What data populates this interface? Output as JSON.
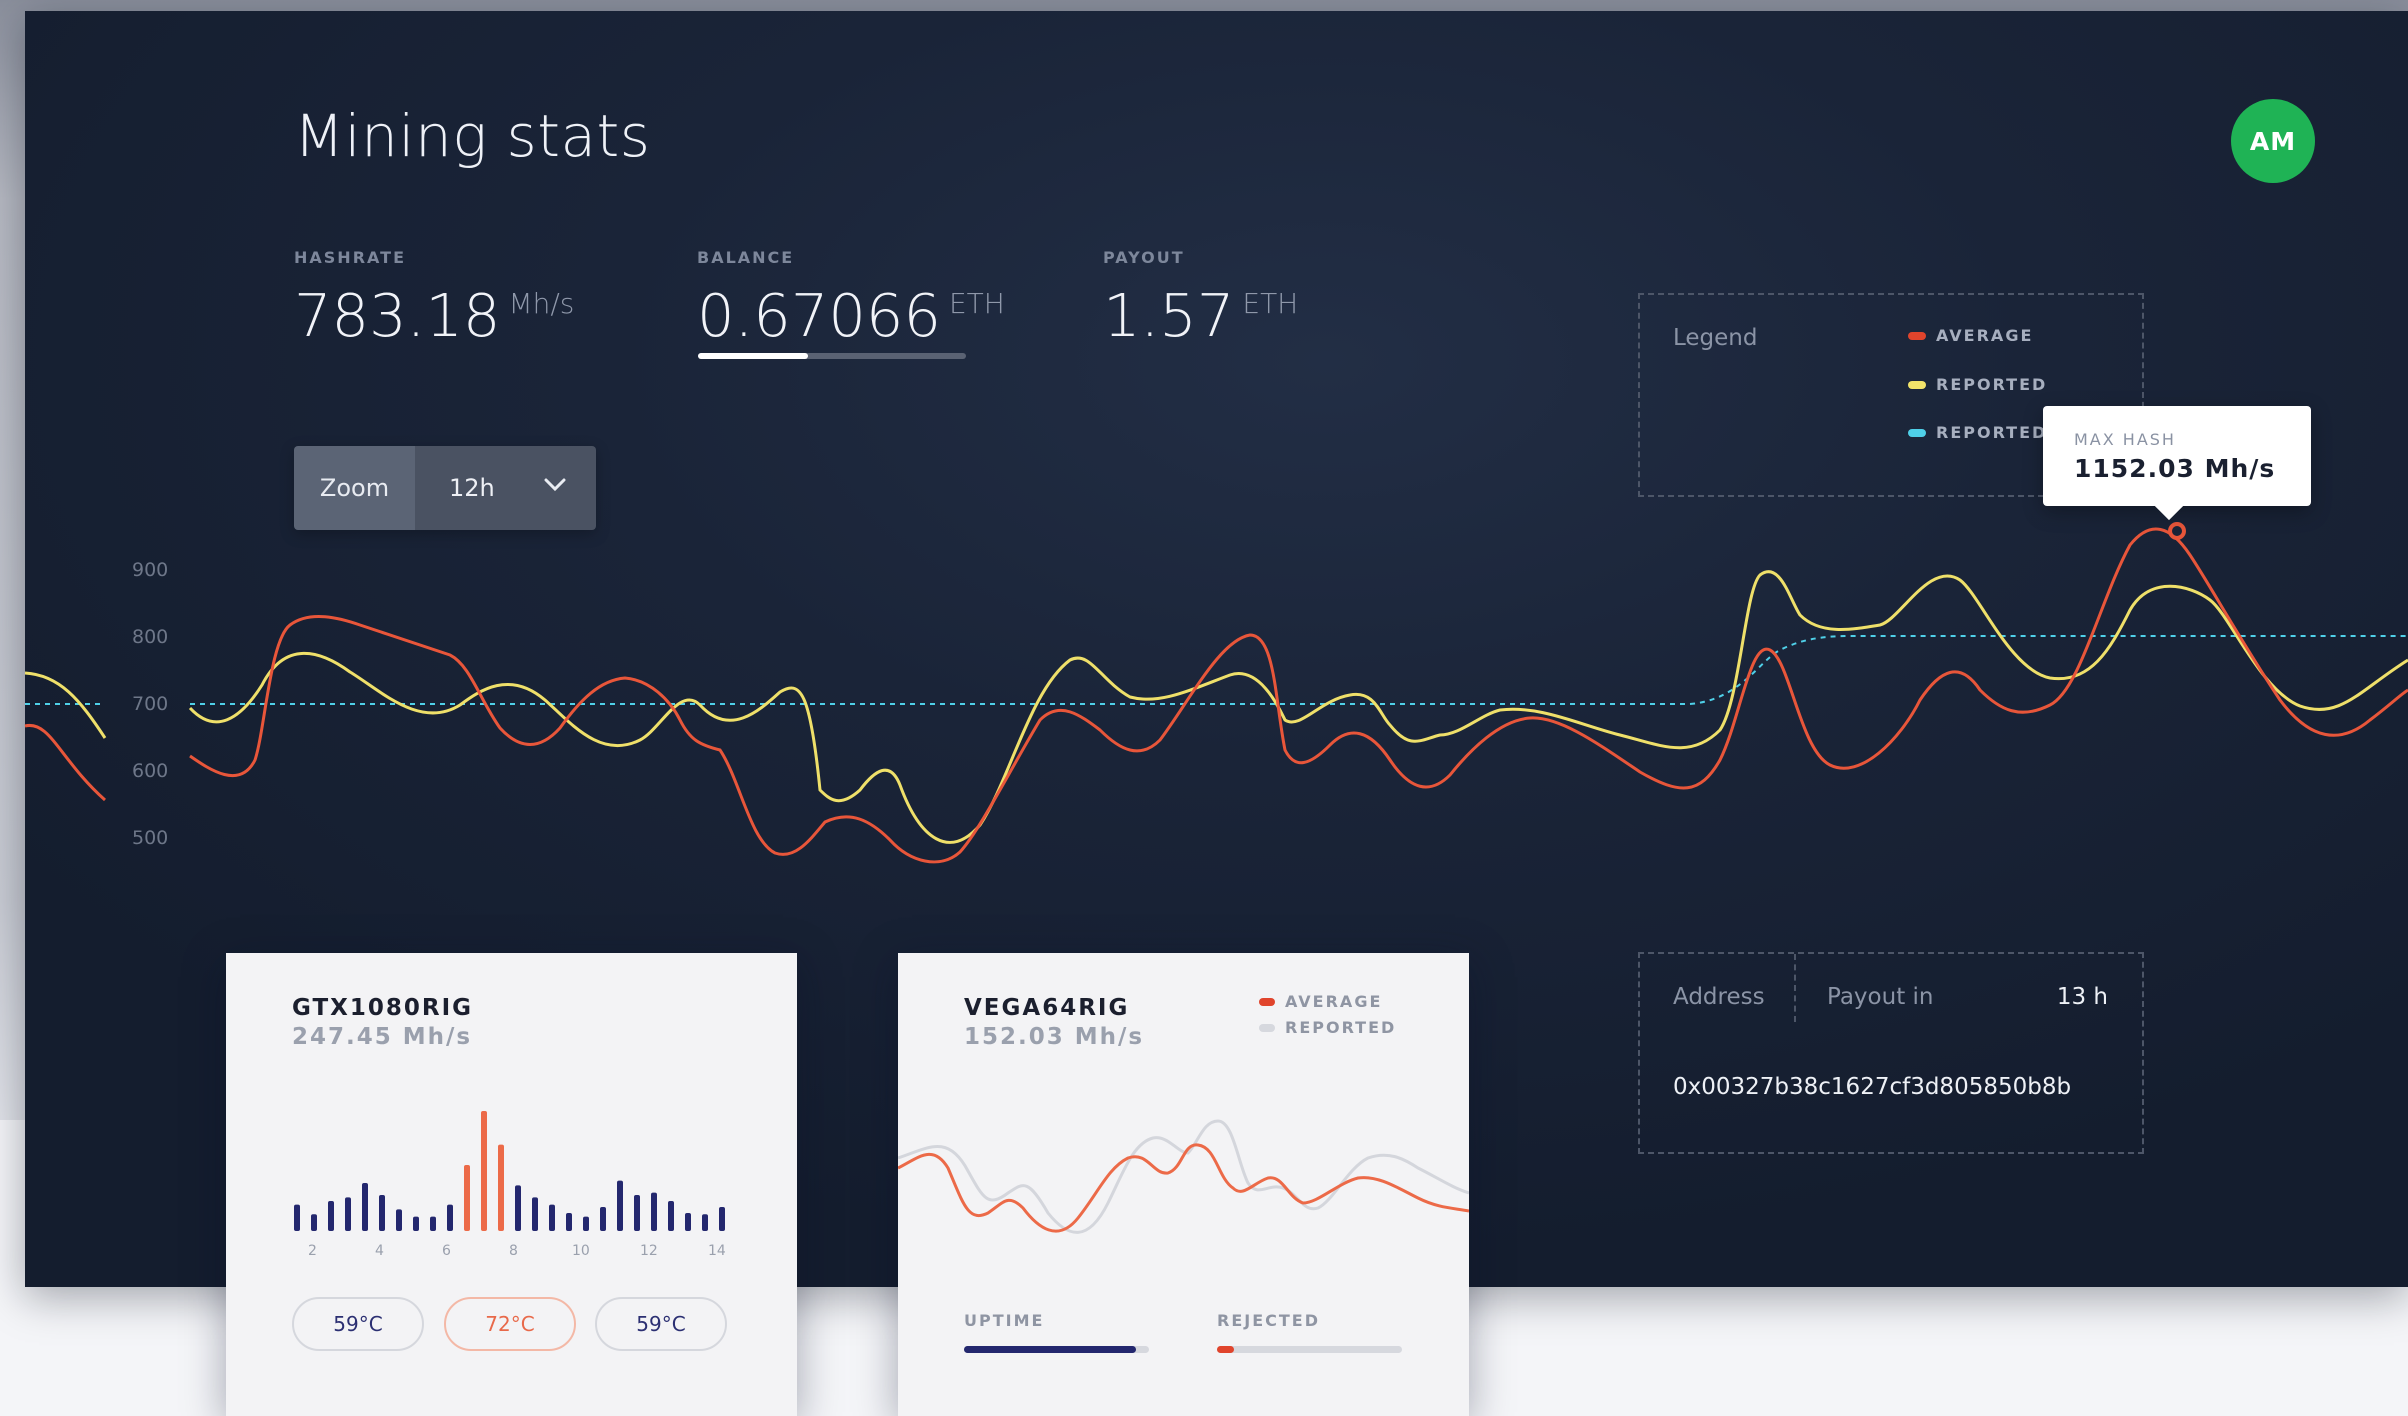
{
  "header": {
    "title": "Mining stats",
    "avatar_initials": "AM"
  },
  "stats": {
    "hashrate": {
      "label": "HASHRATE",
      "value": "783.18",
      "unit": "Mh/s"
    },
    "balance": {
      "label": "BALANCE",
      "value": "0.67066",
      "unit": "ETH",
      "progress": 0.41
    },
    "payout": {
      "label": "PAYOUT",
      "value": "1.57",
      "unit": "ETH"
    }
  },
  "zoom": {
    "label": "Zoom",
    "value": "12h"
  },
  "legend": {
    "title": "Legend",
    "items": [
      {
        "label": "AVERAGE",
        "color": "#e8563a"
      },
      {
        "label": "REPORTED",
        "color": "#f3e46a"
      },
      {
        "label": "REPORTED",
        "color": "#4fd0e8"
      }
    ]
  },
  "tooltip": {
    "label": "MAX HASH",
    "value": "1152.03 Mh/s"
  },
  "chart_data": {
    "type": "line",
    "yticks": [
      "900",
      "800",
      "700",
      "600",
      "500"
    ],
    "series": [
      {
        "name": "AVERAGE",
        "color": "#e8563a"
      },
      {
        "name": "REPORTED",
        "color": "#f3e46a"
      },
      {
        "name": "REPORTED",
        "color": "#4fd0e8"
      }
    ]
  },
  "cards": [
    {
      "title": "GTX1080RIG",
      "subtitle": "247.45 Mh/s",
      "ticks": [
        "2",
        "4",
        "6",
        "8",
        "10",
        "12",
        "14"
      ],
      "bars": [
        0.22,
        0.14,
        0.25,
        0.28,
        0.4,
        0.3,
        0.18,
        0.12,
        0.12,
        0.22,
        0.55,
        1.0,
        0.72,
        0.38,
        0.28,
        0.22,
        0.15,
        0.12,
        0.2,
        0.42,
        0.3,
        0.32,
        0.25,
        0.15,
        0.14,
        0.2
      ],
      "temps": [
        {
          "value": "59°C",
          "hot": false
        },
        {
          "value": "72°C",
          "hot": true
        },
        {
          "value": "59°C",
          "hot": false
        }
      ]
    },
    {
      "title": "VEGA64RIG",
      "subtitle": "152.03 Mh/s",
      "legend": [
        {
          "label": "AVERAGE",
          "color": "#e0442c"
        },
        {
          "label": "REPORTED",
          "color": "#d6d8de"
        }
      ],
      "uptime": {
        "label": "UPTIME",
        "progress": 1.0,
        "color": "#23276e"
      },
      "rejected": {
        "label": "REJECTED",
        "progress": 0.09,
        "color": "#e0442c"
      }
    }
  ],
  "payout_info": {
    "address_label": "Address",
    "payout_label": "Payout in",
    "payout_value": "13 h",
    "address": "0x00327b38c1627cf3d805850b8b"
  },
  "colors": {
    "accent_green": "#1fb355",
    "panel": "#1a2438",
    "average": "#e8563a",
    "reported": "#f3e46a",
    "target": "#4fd0e8"
  }
}
